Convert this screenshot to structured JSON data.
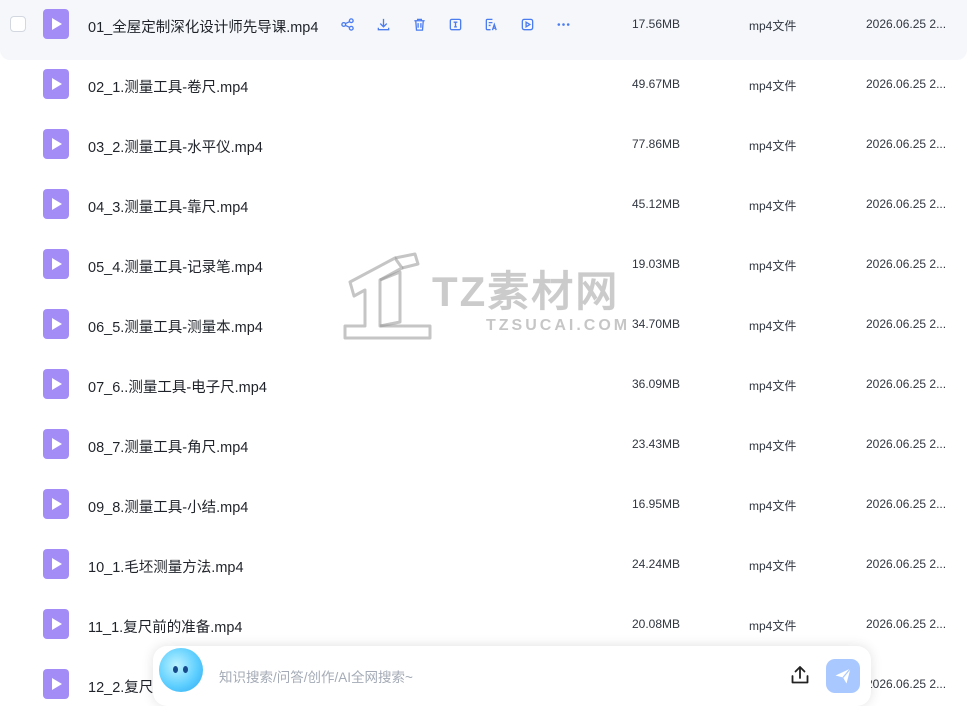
{
  "files": [
    {
      "name": "01_全屋定制深化设计师先导课.mp4",
      "size": "17.56MB",
      "type": "mp4文件",
      "date": "2026.06.25 2..."
    },
    {
      "name": "02_1.测量工具-卷尺.mp4",
      "size": "49.67MB",
      "type": "mp4文件",
      "date": "2026.06.25 2..."
    },
    {
      "name": "03_2.测量工具-水平仪.mp4",
      "size": "77.86MB",
      "type": "mp4文件",
      "date": "2026.06.25 2..."
    },
    {
      "name": "04_3.测量工具-靠尺.mp4",
      "size": "45.12MB",
      "type": "mp4文件",
      "date": "2026.06.25 2..."
    },
    {
      "name": "05_4.测量工具-记录笔.mp4",
      "size": "19.03MB",
      "type": "mp4文件",
      "date": "2026.06.25 2..."
    },
    {
      "name": "06_5.测量工具-测量本.mp4",
      "size": "34.70MB",
      "type": "mp4文件",
      "date": "2026.06.25 2..."
    },
    {
      "name": "07_6..测量工具-电子尺.mp4",
      "size": "36.09MB",
      "type": "mp4文件",
      "date": "2026.06.25 2..."
    },
    {
      "name": "08_7.测量工具-角尺.mp4",
      "size": "23.43MB",
      "type": "mp4文件",
      "date": "2026.06.25 2..."
    },
    {
      "name": "09_8.测量工具-小结.mp4",
      "size": "16.95MB",
      "type": "mp4文件",
      "date": "2026.06.25 2..."
    },
    {
      "name": "10_1.毛坯测量方法.mp4",
      "size": "24.24MB",
      "type": "mp4文件",
      "date": "2026.06.25 2..."
    },
    {
      "name": "11_1.复尺前的准备.mp4",
      "size": "20.08MB",
      "type": "mp4文件",
      "date": "2026.06.25 2..."
    },
    {
      "name": "12_2.复尺",
      "size": "",
      "type": "",
      "date": "2026.06.25 2..."
    }
  ],
  "row_actions": [
    "share-icon",
    "download-icon",
    "delete-icon",
    "rename-icon",
    "text-recognition-icon",
    "play-icon",
    "more-icon"
  ],
  "watermark": {
    "brand": "TZ素材网",
    "domain": "TZSUCAI.COM"
  },
  "search": {
    "placeholder": "知识搜索/问答/创作/AI全网搜索~"
  },
  "colors": {
    "file_icon": "#a48cf7",
    "accent": "#4b7cf0",
    "send_button": "#a9c8ff"
  }
}
